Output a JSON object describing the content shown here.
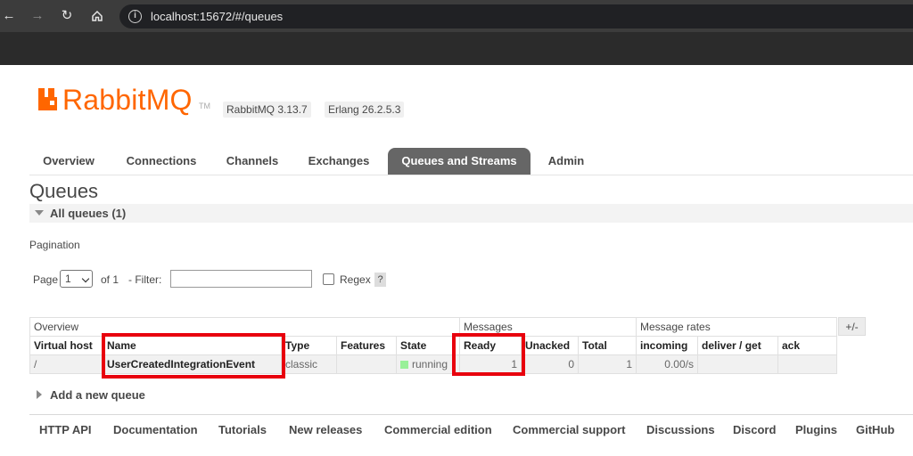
{
  "browser": {
    "url": "localhost:15672/#/queues",
    "back_icon": "arrow-left-icon",
    "forward_icon": "arrow-right-icon",
    "reload_icon": "reload-icon",
    "home_icon": "home-icon",
    "site_info_icon": "info-icon"
  },
  "header": {
    "logo_text": "RabbitMQ",
    "logo_tm": "TM",
    "rabbitmq_version": "RabbitMQ 3.13.7",
    "erlang_version": "Erlang 26.2.5.3",
    "brand_color": "#ff6600"
  },
  "tabs": [
    {
      "label": "Overview"
    },
    {
      "label": "Connections"
    },
    {
      "label": "Channels"
    },
    {
      "label": "Exchanges"
    },
    {
      "label": "Queues and Streams",
      "active": true
    },
    {
      "label": "Admin"
    }
  ],
  "page": {
    "title": "Queues",
    "section_title": "All queues (1)",
    "pagination_label": "Pagination",
    "page_label": "Page",
    "page_value": "1",
    "of_label": "of 1",
    "filter_label": "- Filter:",
    "filter_value": "",
    "regex_label": "Regex",
    "help_label": "?"
  },
  "table": {
    "groups": [
      "Overview",
      "Messages",
      "Message rates"
    ],
    "plus_minus": "+/-",
    "columns": [
      "Virtual host",
      "Name",
      "Type",
      "Features",
      "State",
      "Ready",
      "Unacked",
      "Total",
      "incoming",
      "deliver / get",
      "ack"
    ],
    "rows": [
      {
        "virtual_host": "/",
        "name": "UserCreatedIntegrationEvent",
        "type": "classic",
        "features": "",
        "state": "running",
        "ready": "1",
        "unacked": "0",
        "total": "1",
        "incoming": "0.00/s",
        "deliver_get": "",
        "ack": ""
      }
    ],
    "highlight_color": "#e8000d"
  },
  "add_queue_label": "Add a new queue",
  "footer": [
    "HTTP API",
    "Documentation",
    "Tutorials",
    "New releases",
    "Commercial edition",
    "Commercial support",
    "Discussions",
    "Discord",
    "Plugins",
    "GitHub"
  ]
}
